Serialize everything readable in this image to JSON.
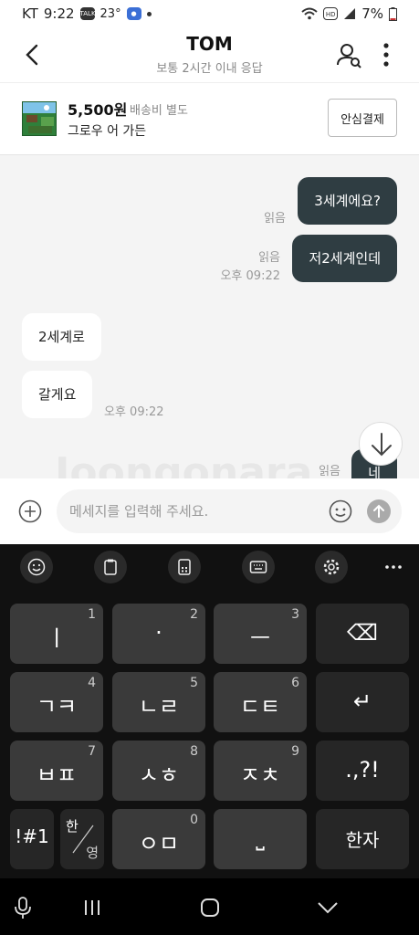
{
  "status": {
    "carrier": "KT",
    "time": "9:22",
    "temp": "23°",
    "battery": "7%"
  },
  "header": {
    "title": "TOM",
    "subtitle": "보통 2시간 이내 응답"
  },
  "product": {
    "price": "5,500원",
    "shipping": "배송비 별도",
    "title": "그로우 어 가든",
    "pay_button": "안심결제"
  },
  "messages": [
    {
      "side": "me",
      "text": "3세계에요?",
      "read": "읽음",
      "time": ""
    },
    {
      "side": "me",
      "text": "저2세계인데",
      "read": "읽음",
      "time": "오후 09:22"
    },
    {
      "side": "them",
      "text": "2세계로",
      "time": ""
    },
    {
      "side": "them",
      "text": "갈게요",
      "time": "오후 09:22"
    },
    {
      "side": "me",
      "text": "네",
      "read": "읽음",
      "time": ""
    }
  ],
  "watermark": "Joongonara",
  "composer": {
    "placeholder": "메세지를 입력해 주세요."
  },
  "keyboard": {
    "keys": [
      {
        "main": "ㅣ",
        "sub": "1"
      },
      {
        "main": "·",
        "sub": "2"
      },
      {
        "main": "ㅡ",
        "sub": "3"
      },
      {
        "main": "⌫",
        "sub": ""
      },
      {
        "main": "ㄱㅋ",
        "sub": "4"
      },
      {
        "main": "ㄴㄹ",
        "sub": "5"
      },
      {
        "main": "ㄷㅌ",
        "sub": "6"
      },
      {
        "main": "↵",
        "sub": ""
      },
      {
        "main": "ㅂㅍ",
        "sub": "7"
      },
      {
        "main": "ㅅㅎ",
        "sub": "8"
      },
      {
        "main": "ㅈㅊ",
        "sub": "9"
      },
      {
        "main": ".,?!",
        "sub": ""
      },
      {
        "main": "!#1",
        "sub": ""
      },
      {
        "main": "",
        "sub": ""
      },
      {
        "main": "ㅇㅁ",
        "sub": "0"
      },
      {
        "main": "⎵",
        "sub": ""
      },
      {
        "main": "한자",
        "sub": ""
      }
    ],
    "lang_toggle": {
      "top": "한",
      "bottom": "영"
    }
  }
}
